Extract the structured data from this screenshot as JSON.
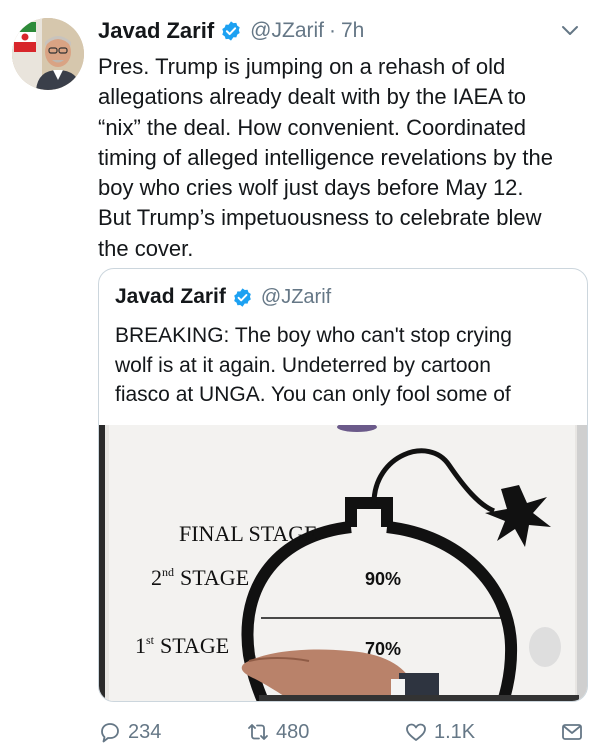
{
  "tweet": {
    "author_name": "Javad Zarif",
    "handle": "@JZarif",
    "separator": "·",
    "time": "7h",
    "text_lines": [
      "Pres. Trump is jumping on a rehash of old",
      "allegations already dealt with by the IAEA to",
      "“nix” the deal. How convenient. Coordinated",
      "timing of alleged intelligence revelations by the",
      "boy who cries wolf just days before May 12.",
      "But Trump’s impetuousness to celebrate blew",
      "the cover."
    ]
  },
  "quoted_tweet": {
    "author_name": "Javad Zarif",
    "handle": "@JZarif",
    "text_lines": [
      "BREAKING: The boy who can't stop crying",
      "wolf is at it again. Undeterred by cartoon",
      "fiasco at UNGA. You can only fool some of"
    ],
    "media": {
      "final_stage": "FINAL STAGE",
      "second_stage_num": "2",
      "second_stage_sup": "nd",
      "second_stage_word": "STAGE",
      "second_pct": "90%",
      "first_stage_num": "1",
      "first_stage_sup": "st",
      "first_stage_word": "STAGE",
      "first_pct": "70%"
    }
  },
  "actions": {
    "replies": "234",
    "retweets": "480",
    "likes": "1.1K"
  },
  "icons": {
    "verified": "verified-badge-icon",
    "caret": "chevron-down-icon",
    "reply": "reply-icon",
    "retweet": "retweet-icon",
    "like": "heart-icon",
    "dm": "direct-message-icon"
  },
  "colors": {
    "text": "#14171a",
    "secondary": "#657786",
    "verified": "#1da1f2",
    "border": "#ccd6dd"
  }
}
